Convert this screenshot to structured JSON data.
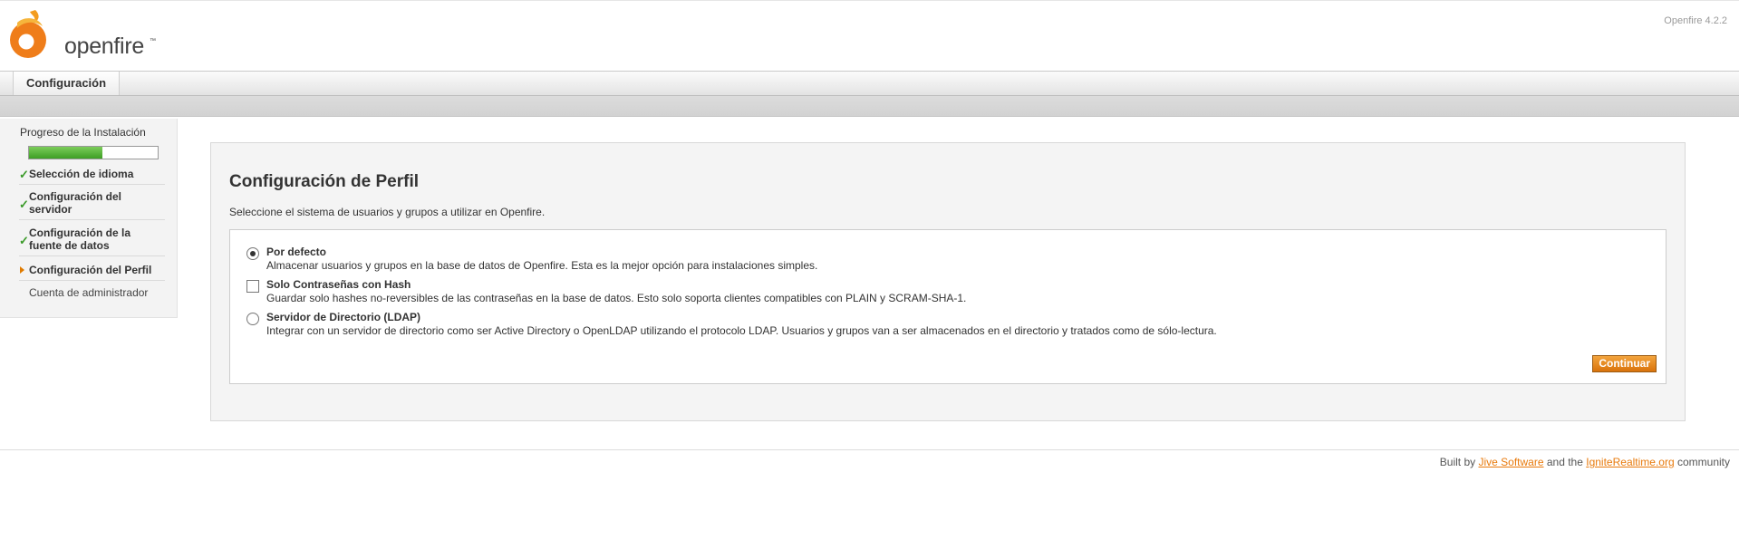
{
  "header": {
    "logo_text": "openfire",
    "logo_tm": "™",
    "version": "Openfire 4.2.2"
  },
  "tabs": [
    {
      "label": "Configuración",
      "active": true
    }
  ],
  "sidebar": {
    "progress_title": "Progreso de la Instalación",
    "progress_fraction": 0.57,
    "steps": [
      {
        "label": "Selección de idioma",
        "status": "done"
      },
      {
        "label": "Configuración del servidor",
        "status": "done"
      },
      {
        "label": "Configuración de la fuente de datos",
        "status": "done"
      },
      {
        "label": "Configuración del Perfil",
        "status": "current"
      },
      {
        "label": "Cuenta de administrador",
        "status": "pending"
      }
    ]
  },
  "main": {
    "title": "Configuración de Perfil",
    "intro": "Seleccione el sistema de usuarios y grupos a utilizar en Openfire.",
    "options": [
      {
        "title": "Por defecto",
        "description": "Almacenar usuarios y grupos en la base de datos de Openfire. Esta es la mejor opción para instalaciones simples.",
        "selected": true,
        "control": "radio"
      },
      {
        "title": "Solo Contraseñas con Hash",
        "description": "Guardar solo hashes no-reversibles de las contraseñas en la base de datos. Esto solo soporta clientes compatibles con PLAIN y SCRAM-SHA-1.",
        "selected": false,
        "control": "checkbox"
      },
      {
        "title": "Servidor de Directorio (LDAP)",
        "description": "Integrar con un servidor de directorio como ser Active Directory o OpenLDAP utilizando el protocolo LDAP. Usuarios y grupos van a ser almacenados en el directorio y tratados como de sólo-lectura.",
        "selected": false,
        "control": "radio"
      }
    ],
    "continue_label": "Continuar"
  },
  "footer": {
    "prefix": "Built by",
    "link1": "Jive Software",
    "middle": "and the",
    "link2": "IgniteRealtime.org",
    "suffix": "community"
  },
  "colors": {
    "accent": "#e87a0c",
    "progress": "#4aa82d",
    "check": "#3a9a28"
  },
  "icons": {
    "logo": "openfire-flame-icon",
    "done_step": "checkmark-icon",
    "current_step": "arrow-right-icon"
  }
}
